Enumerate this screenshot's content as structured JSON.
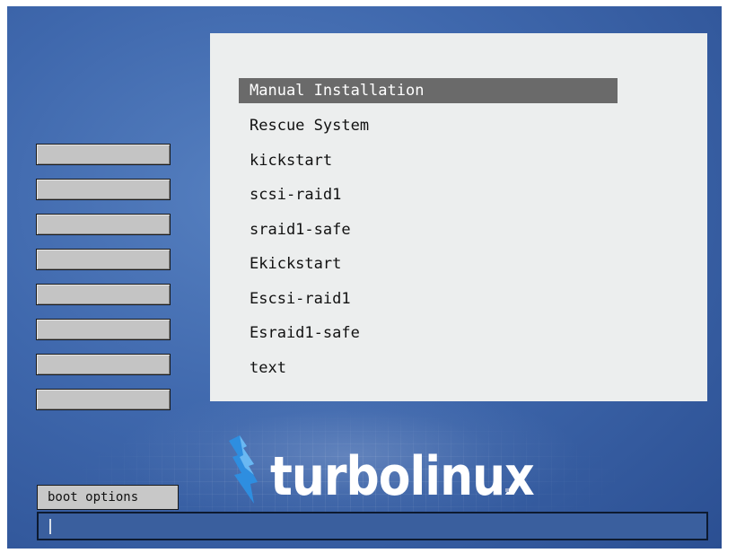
{
  "menu": {
    "items": [
      {
        "label": "Manual Installation",
        "selected": true
      },
      {
        "label": "Rescue System",
        "selected": false
      },
      {
        "label": "kickstart",
        "selected": false
      },
      {
        "label": "scsi-raid1",
        "selected": false
      },
      {
        "label": "sraid1-safe",
        "selected": false
      },
      {
        "label": "Ekickstart",
        "selected": false
      },
      {
        "label": "Escsi-raid1",
        "selected": false
      },
      {
        "label": "Esraid1-safe",
        "selected": false
      },
      {
        "label": "text",
        "selected": false
      }
    ]
  },
  "sidebar": {
    "buttons": [
      "",
      "",
      "",
      "",
      "",
      "",
      "",
      ""
    ]
  },
  "logo": {
    "text": "turbolinux",
    "icon": "lightning-bolt-icon"
  },
  "boot": {
    "tab_label": "boot options",
    "input_value": ""
  },
  "colors": {
    "background": "#3f68ad",
    "panel": "#eceeee",
    "selection": "#6a6a6a",
    "button": "#c4c4c4"
  }
}
